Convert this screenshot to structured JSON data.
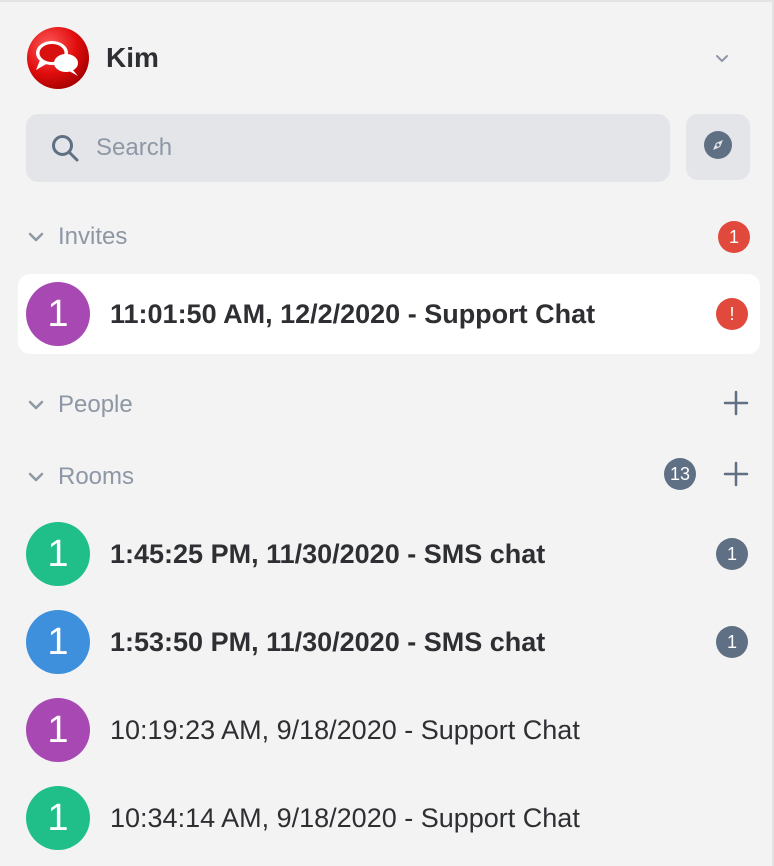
{
  "user": {
    "name": "Kim",
    "logo_icon": "chat-bubbles-logo-icon"
  },
  "search": {
    "placeholder": "Search"
  },
  "colors": {
    "purple": "#a848b3",
    "green": "#20bf8a",
    "blue": "#3f90dc",
    "badge_red": "#e0493c",
    "badge_grey": "#5f6f84"
  },
  "sections": {
    "invites": {
      "title": "Invites",
      "badge": "1",
      "items": [
        {
          "avatar_letter": "1",
          "avatar_color": "purple",
          "name": "11:01:50 AM, 12/2/2020 - Support Chat",
          "badge": "!"
        }
      ]
    },
    "people": {
      "title": "People"
    },
    "rooms": {
      "title": "Rooms",
      "badge": "13",
      "items": [
        {
          "avatar_letter": "1",
          "avatar_color": "green",
          "name": "1:45:25 PM, 11/30/2020 - SMS chat",
          "badge": "1"
        },
        {
          "avatar_letter": "1",
          "avatar_color": "blue",
          "name": "1:53:50 PM, 11/30/2020 - SMS chat",
          "badge": "1"
        },
        {
          "avatar_letter": "1",
          "avatar_color": "purple",
          "name": "10:19:23 AM, 9/18/2020 - Support Chat"
        },
        {
          "avatar_letter": "1",
          "avatar_color": "green",
          "name": "10:34:14 AM, 9/18/2020 - Support Chat"
        }
      ]
    }
  }
}
